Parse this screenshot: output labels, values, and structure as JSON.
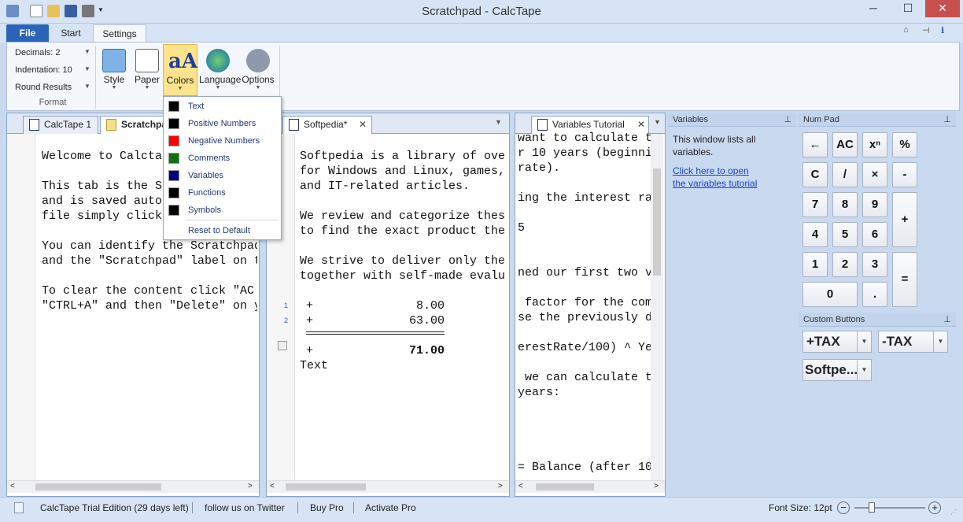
{
  "window": {
    "title": "Scratchpad - CalcTape",
    "minimize": "─",
    "maximize": "☐",
    "close": "✕"
  },
  "ribbon": {
    "tabs": {
      "file": "File",
      "start": "Start",
      "settings": "Settings"
    },
    "format": {
      "decimals": "Decimals: 2",
      "indentation": "Indentation: 10",
      "round": "Round Results",
      "group_label": "Format"
    },
    "buttons": {
      "style": "Style",
      "paper": "Paper",
      "colors": "Colors",
      "language": "Language",
      "options": "Options"
    }
  },
  "color_menu": {
    "items": [
      {
        "label": "Text",
        "color": "#000000"
      },
      {
        "label": "Positive Numbers",
        "color": "#000000"
      },
      {
        "label": "Negative Numbers",
        "color": "#ff0000"
      },
      {
        "label": "Comments",
        "color": "#107010"
      },
      {
        "label": "Variables",
        "color": "#000080"
      },
      {
        "label": "Functions",
        "color": "#000000"
      },
      {
        "label": "Symbols",
        "color": "#000000"
      }
    ],
    "reset": "Reset to Default"
  },
  "pane1": {
    "tabs": {
      "t1": "CalcTape 1",
      "t2": "Scratchpad"
    },
    "lines": [
      "Welcome to Calcta",
      "",
      "This tab is the S",
      "and is saved auto",
      "file simply click",
      "",
      "You can identify the Scratchpad",
      "and the \"Scratchpad\" label on t",
      "",
      "To clear the content click \"AC",
      "\"CTRL+A\" and then \"Delete\" on y"
    ]
  },
  "pane2": {
    "tab": "Softpedia*",
    "lines": [
      "Softpedia is a library of ove",
      "for Windows and Linux, games,",
      "and IT-related articles.",
      "",
      "We review and categorize thes",
      "to find the exact product the",
      "",
      "We strive to deliver only the",
      "together with self-made evalu"
    ],
    "calc": {
      "line1_num": "1",
      "line2_num": "2",
      "op1": "+",
      "val1": "8.00",
      "op2": "+",
      "val2": "63.00",
      "op_total": "+",
      "total": "71.00",
      "trailing": "Text"
    }
  },
  "pane3": {
    "tab": "Variables Tutorial",
    "lines": [
      "want to calculate t",
      "r 10 years (beginni",
      "rate).",
      "",
      "ing the interest ra",
      "",
      "5",
      "",
      "",
      "ned our first two v",
      "",
      " factor for the com",
      "se the previously d",
      "",
      "erestRate/100) ^ Ye",
      "",
      " we can calculate t",
      "years:",
      "",
      "",
      "",
      "",
      "= Balance (after 10"
    ]
  },
  "variables_panel": {
    "title": "Variables",
    "text": "This window lists all variables.",
    "link1": "Click here to open",
    "link2": "the variables tutorial"
  },
  "numpad": {
    "title": "Num Pad",
    "keys": {
      "back": "←",
      "ac": "AC",
      "pow": "xⁿ",
      "pct": "%",
      "c": "C",
      "div": "/",
      "mul": "×",
      "minus": "-",
      "k7": "7",
      "k8": "8",
      "k9": "9",
      "plus": "+",
      "k4": "4",
      "k5": "5",
      "k6": "6",
      "k1": "1",
      "k2": "2",
      "k3": "3",
      "eq": "=",
      "k0": "0",
      "dot": "."
    }
  },
  "custom_buttons": {
    "title": "Custom Buttons",
    "b1": "+TAX",
    "b2": "-TAX",
    "b3": "Softpe..."
  },
  "status": {
    "edition": "CalcTape Trial Edition (29 days left)",
    "twitter": "follow us on Twitter",
    "buy": "Buy Pro",
    "activate": "Activate Pro",
    "font_size": "Font Size: 12pt",
    "minus": "−",
    "plus": "+"
  }
}
